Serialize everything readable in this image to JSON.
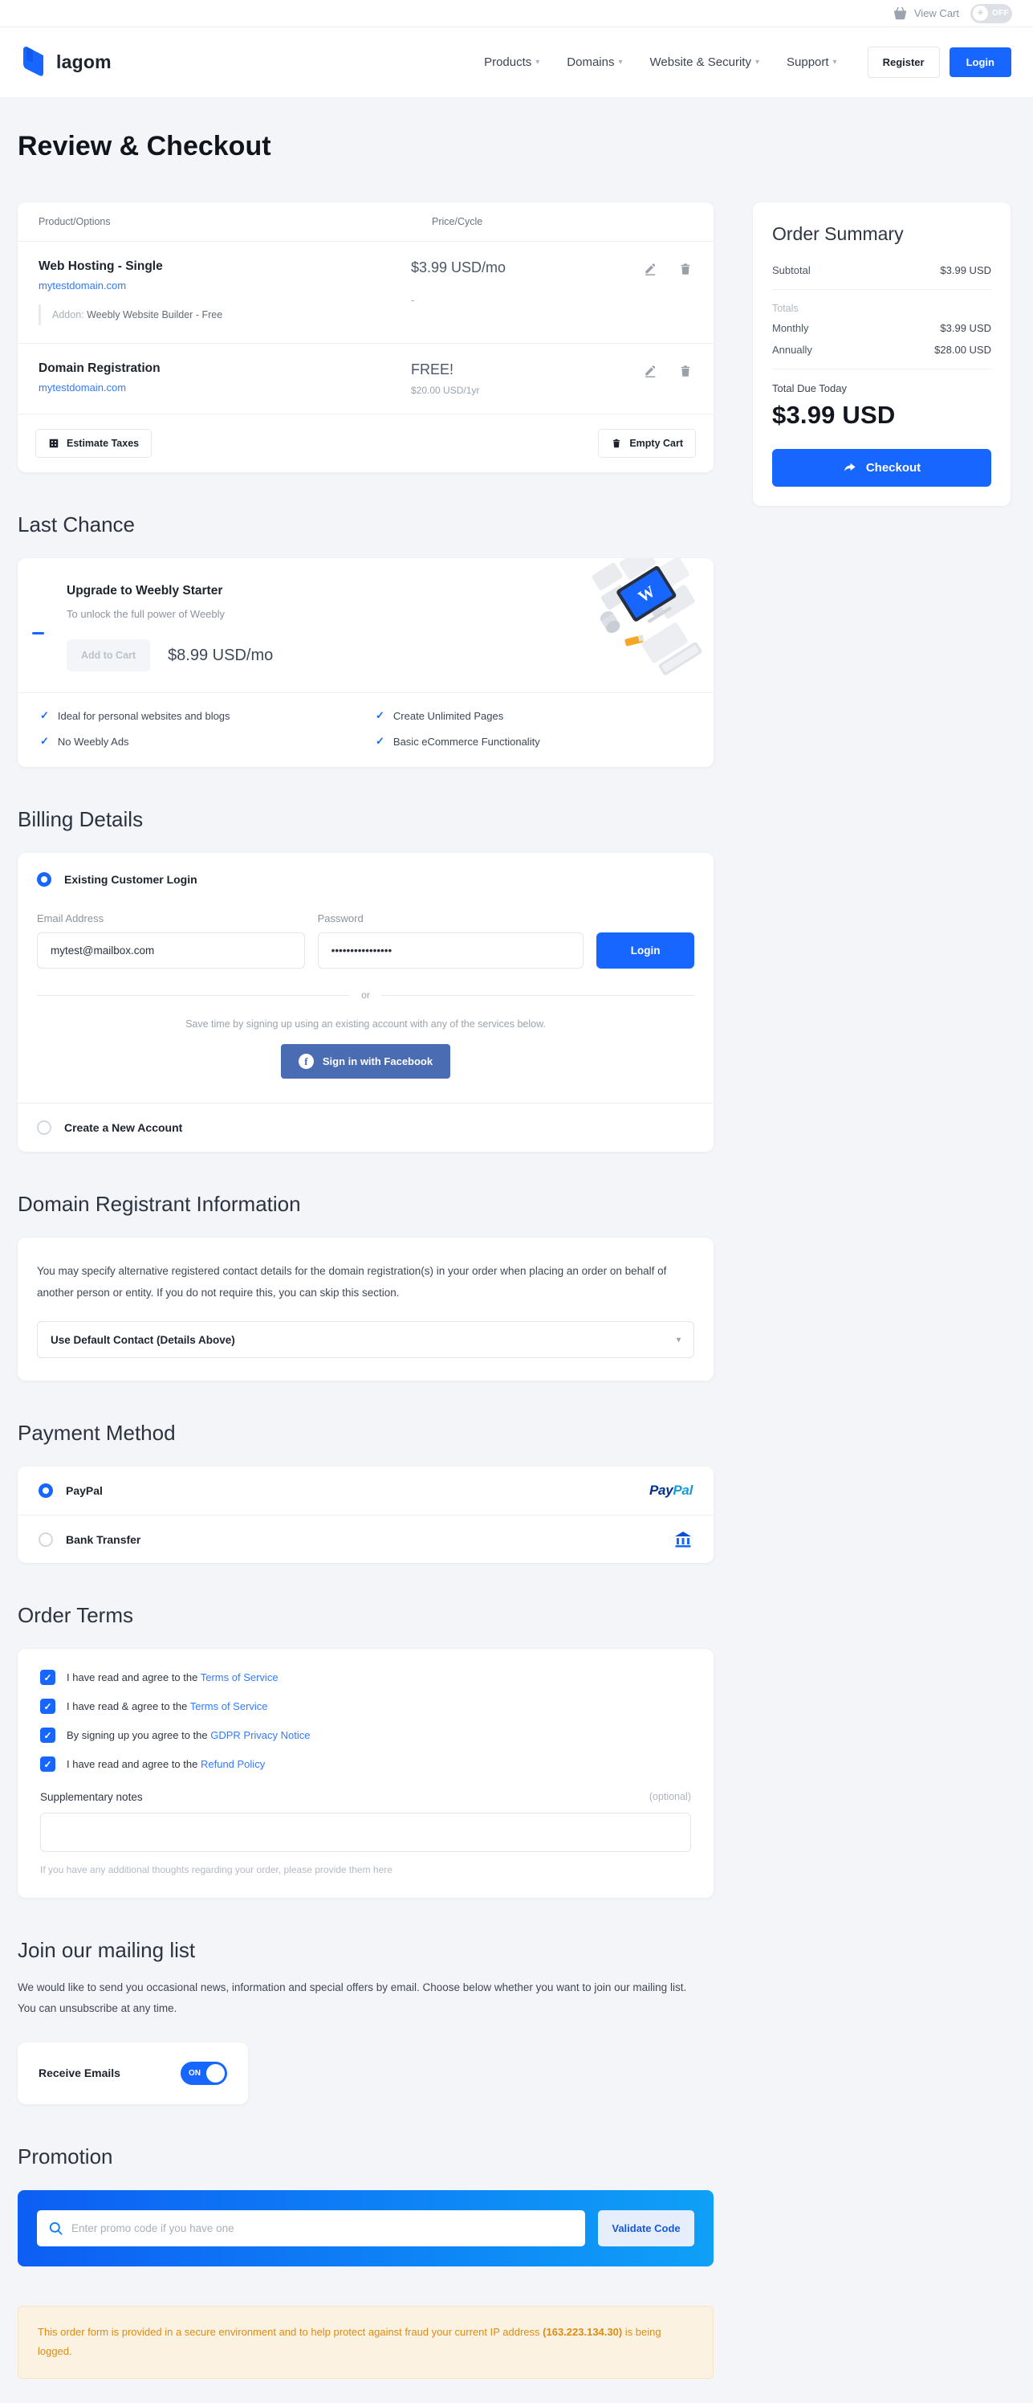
{
  "icons": {
    "check": "✓",
    "caret": "▾",
    "sun": "✳",
    "or_divider": "or"
  },
  "colors": {
    "primary": "#1766ff",
    "facebook": "#4a6cb3",
    "paypal_dark": "#013087",
    "paypal_light": "#169bd8",
    "notice_text": "#dd8b13"
  },
  "topbar": {
    "view_cart_label": "View Cart",
    "theme_toggle_label": "OFF"
  },
  "header": {
    "brand": "lagom",
    "nav": [
      {
        "label": "Products"
      },
      {
        "label": "Domains"
      },
      {
        "label": "Website & Security"
      },
      {
        "label": "Support"
      }
    ],
    "register_label": "Register",
    "login_label": "Login"
  },
  "page": {
    "title": "Review & Checkout"
  },
  "cart": {
    "columns": {
      "product": "Product/Options",
      "price": "Price/Cycle"
    },
    "rows": [
      {
        "name": "Web Hosting - Single",
        "domain": "mytestdomain.com",
        "addon_label": "Addon:",
        "addon_value": "Weebly Website Builder - Free",
        "price": "$3.99 USD/mo",
        "addon_price": "-"
      },
      {
        "name": "Domain Registration",
        "domain": "mytestdomain.com",
        "price": "FREE!",
        "price_sub": "$20.00 USD/1yr"
      }
    ],
    "estimate_taxes_label": "Estimate Taxes",
    "empty_cart_label": "Empty Cart"
  },
  "order_summary": {
    "title": "Order Summary",
    "subtotal_label": "Subtotal",
    "subtotal_value": "$3.99 USD",
    "totals_label": "Totals",
    "monthly_label": "Monthly",
    "monthly_value": "$3.99 USD",
    "annually_label": "Annually",
    "annually_value": "$28.00 USD",
    "total_due_label": "Total Due Today",
    "total_due_value": "$3.99 USD",
    "checkout_label": "Checkout"
  },
  "last_chance": {
    "heading": "Last Chance",
    "title": "Upgrade to Weebly Starter",
    "subtitle": "To unlock the full power of Weebly",
    "add_to_cart_label": "Add to Cart",
    "price": "$8.99 USD/mo",
    "features_left": [
      "Ideal for personal websites and blogs",
      "No Weebly Ads"
    ],
    "features_right": [
      "Create Unlimited Pages",
      "Basic eCommerce Functionality"
    ]
  },
  "billing": {
    "heading": "Billing Details",
    "existing_login_label": "Existing Customer Login",
    "email_label": "Email Address",
    "email_value": "mytest@mailbox.com",
    "password_label": "Password",
    "password_value": "••••••••••••••••",
    "login_label": "Login",
    "or_label": "or",
    "social_hint": "Save time by signing up using an existing account with any of the services below.",
    "facebook_label": "Sign in with Facebook",
    "facebook_f": "f",
    "create_account_label": "Create a New Account"
  },
  "registrant": {
    "heading": "Domain Registrant Information",
    "description": "You may specify alternative registered contact details for the domain registration(s) in your order when placing an order on behalf of another person or entity. If you do not require this, you can skip this section.",
    "select_value": "Use Default Contact (Details Above)"
  },
  "payment": {
    "heading": "Payment Method",
    "methods": [
      {
        "label": "PayPal"
      },
      {
        "label": "Bank Transfer"
      }
    ],
    "paypal_logo": {
      "pay": "Pay",
      "pal": "Pal"
    }
  },
  "terms": {
    "heading": "Order Terms",
    "items": [
      {
        "text": "I have read and agree to the",
        "link": "Terms of Service"
      },
      {
        "text": "I have read & agree to the",
        "link": "Terms of Service"
      },
      {
        "text": "By signing up you agree to the",
        "link": "GDPR Privacy Notice"
      },
      {
        "text": "I have read and agree to the",
        "link": "Refund Policy"
      }
    ],
    "notes_label": "Supplementary notes",
    "notes_optional": "(optional)",
    "notes_help": "If you have any additional thoughts regarding your order, please provide them here"
  },
  "mailing": {
    "heading": "Join our mailing list",
    "description": "We would like to send you occasional news, information and special offers by email. Choose below whether you want to join our mailing list. You can unsubscribe at any time.",
    "receive_label": "Receive Emails",
    "toggle_state": "ON"
  },
  "promotion": {
    "heading": "Promotion",
    "placeholder": "Enter promo code if you have one",
    "validate_label": "Validate Code"
  },
  "notice": {
    "text_before": "This order form is provided in a secure environment and to help protect against fraud your current IP address ",
    "ip": "(163.223.134.30)",
    "text_after": " is being logged."
  }
}
